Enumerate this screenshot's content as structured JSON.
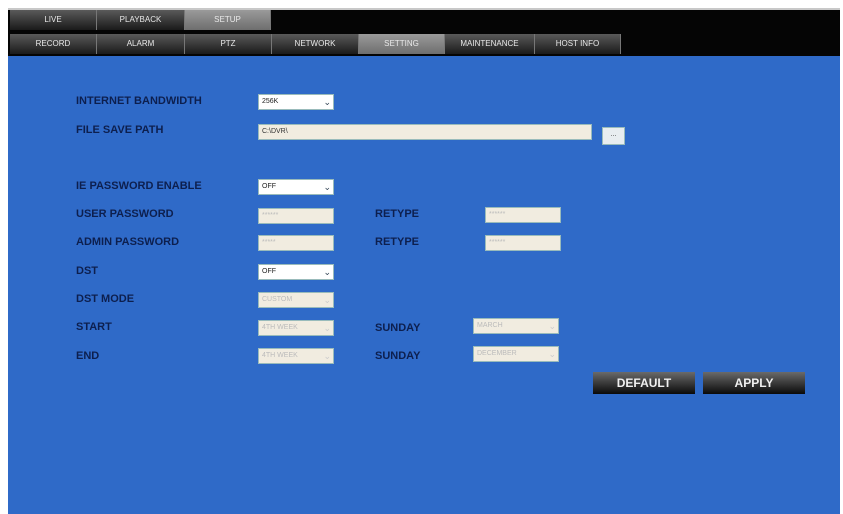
{
  "top_tabs": [
    "LIVE",
    "PLAYBACK",
    "SETUP"
  ],
  "sub_tabs": [
    "RECORD",
    "ALARM",
    "PTZ",
    "NETWORK",
    "SETTING",
    "MAINTENANCE",
    "HOST INFO"
  ],
  "form": {
    "bandwidth_label": "INTERNET BANDWIDTH",
    "bandwidth_value": "256K",
    "path_label": "FILE SAVE PATH",
    "path_value": "C:\\DVR\\",
    "browse_label": "...",
    "ie_label": "IE PASSWORD ENABLE",
    "ie_value": "OFF",
    "user_pw_label": "USER PASSWORD",
    "user_pw_value": "******",
    "admin_pw_label": "ADMIN PASSWORD",
    "admin_pw_value": "*****",
    "retype_label": "RETYPE",
    "retype_user_value": "******",
    "retype_admin_value": "******",
    "dst_label": "DST",
    "dst_value": "OFF",
    "dst_mode_label": "DST MODE",
    "dst_mode_value": "CUSTOM",
    "start_label": "START",
    "start_week": "4TH WEEK",
    "start_day_label": "SUNDAY",
    "start_month": "MARCH",
    "end_label": "END",
    "end_week": "4TH WEEK",
    "end_day_label": "SUNDAY",
    "end_month": "DECEMBER"
  },
  "buttons": {
    "default": "DEFAULT",
    "apply": "APPLY"
  }
}
